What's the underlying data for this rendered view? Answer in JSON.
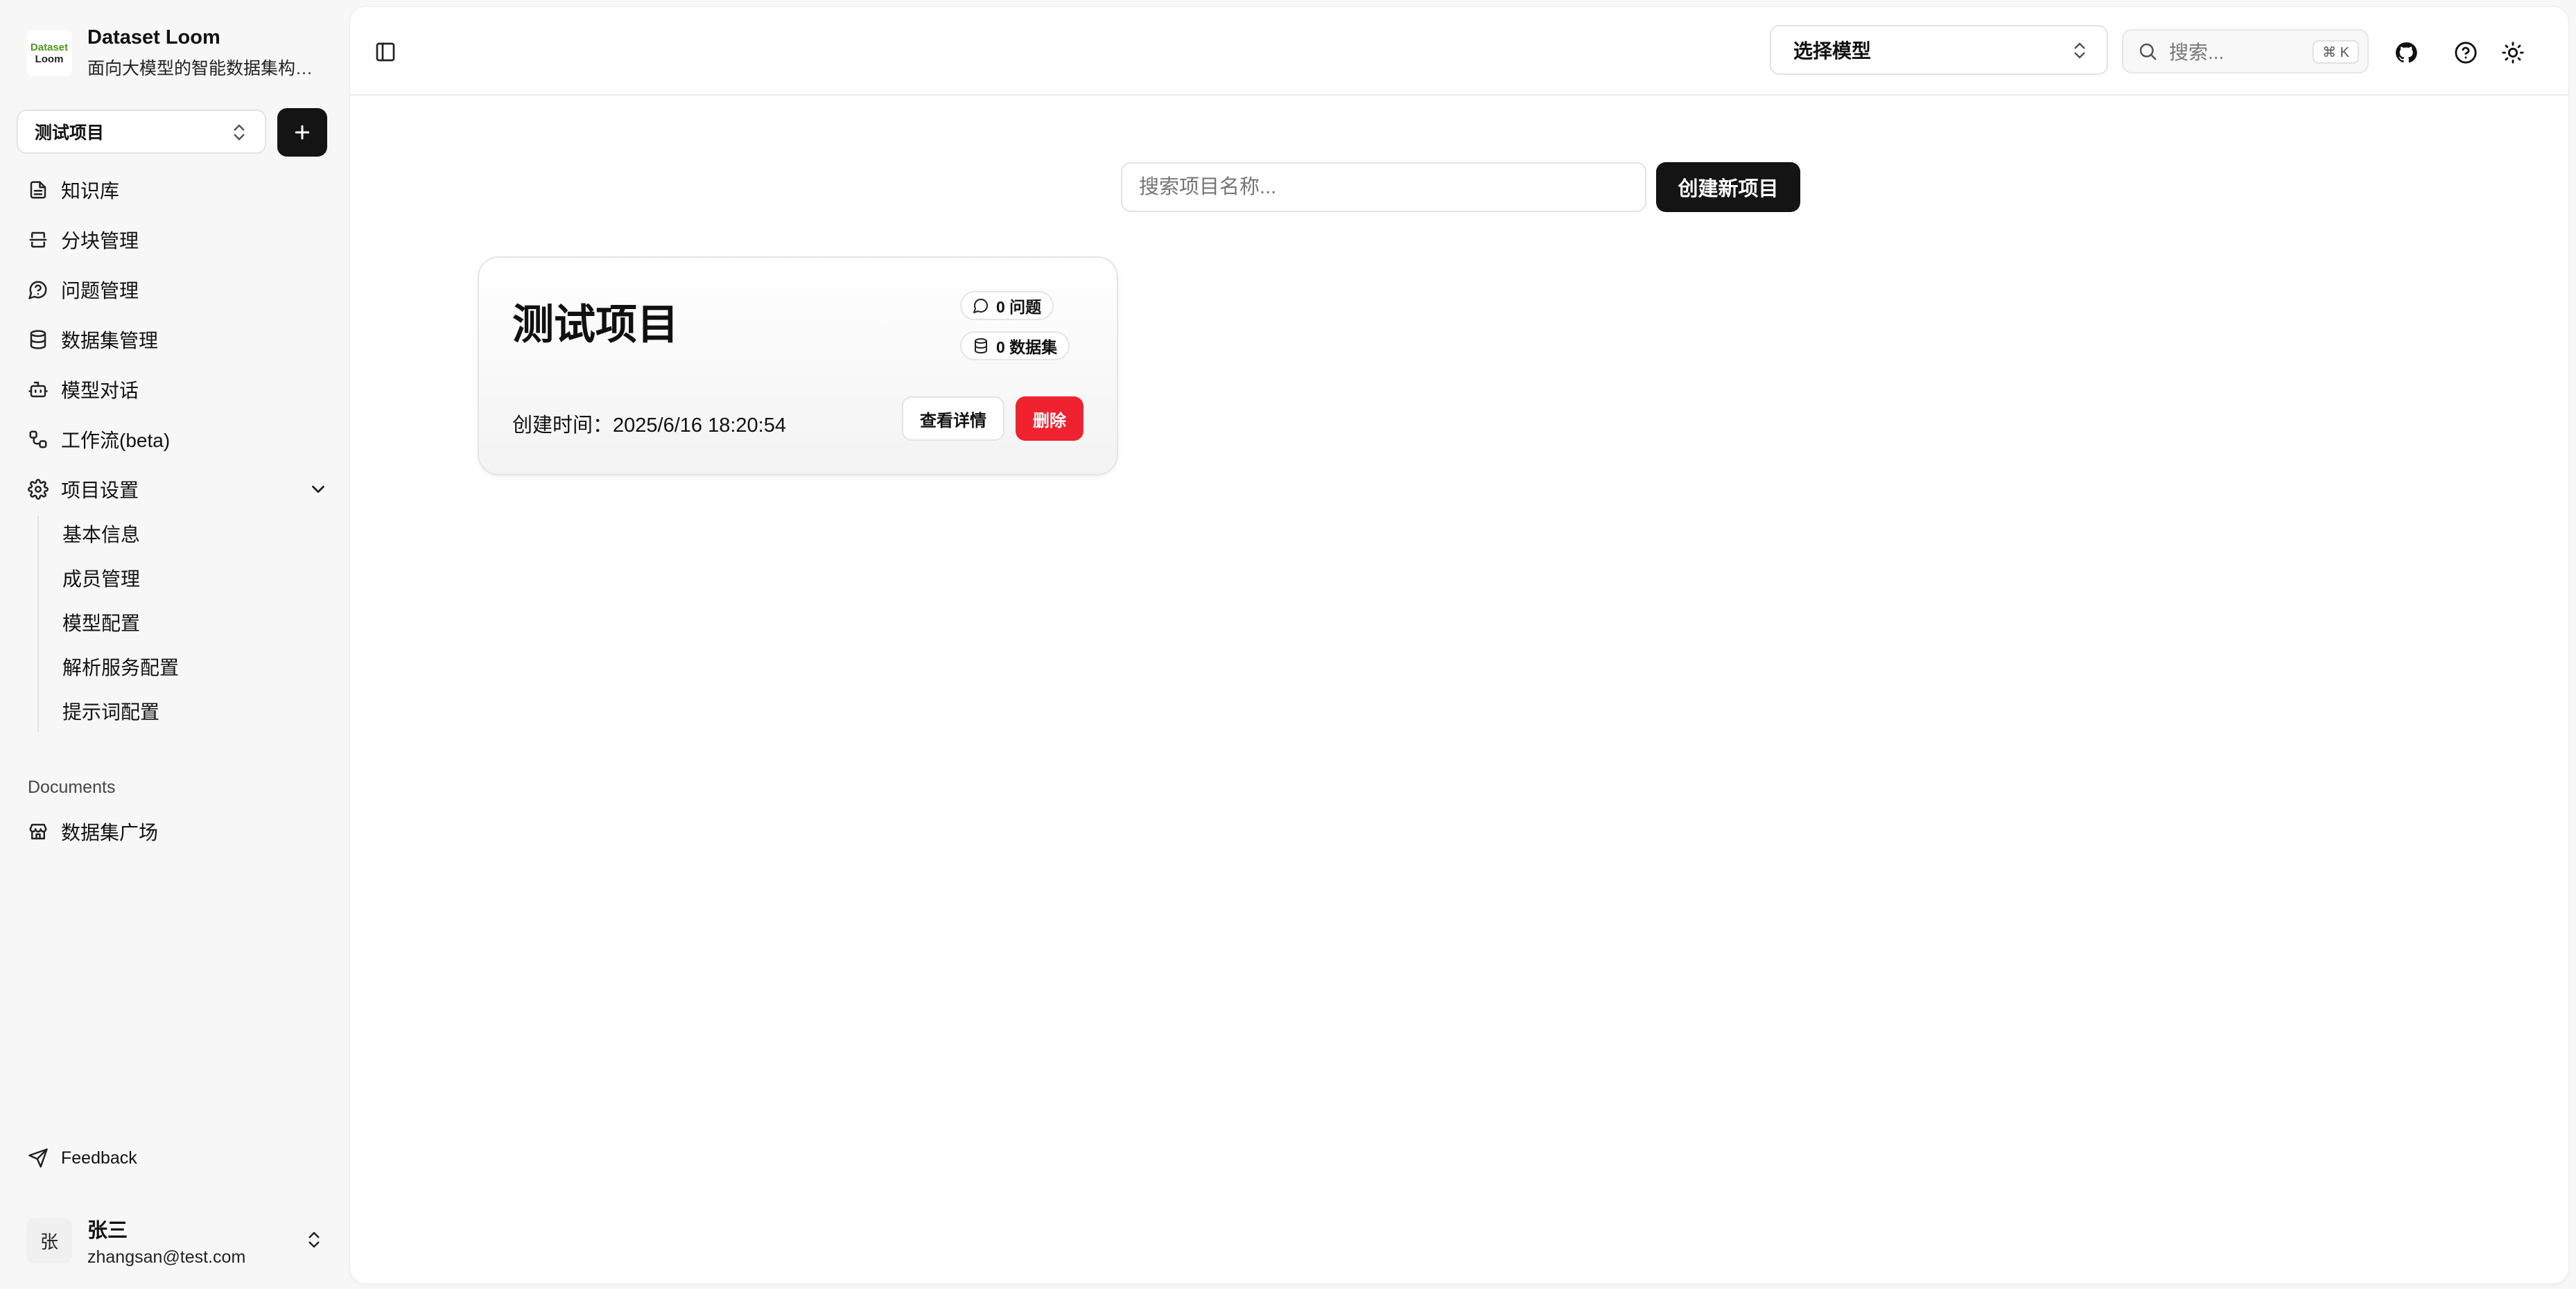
{
  "brand": {
    "logo_top": "Dataset",
    "logo_bottom": "Loom",
    "title": "Dataset Loom",
    "subtitle": "面向大模型的智能数据集构建..."
  },
  "project_selector": {
    "value": "测试项目"
  },
  "nav": {
    "items": [
      {
        "label": "知识库",
        "icon": "file-text-icon"
      },
      {
        "label": "分块管理",
        "icon": "split-icon"
      },
      {
        "label": "问题管理",
        "icon": "message-circle-question-icon"
      },
      {
        "label": "数据集管理",
        "icon": "database-icon"
      },
      {
        "label": "模型对话",
        "icon": "bot-icon"
      },
      {
        "label": "工作流(beta)",
        "icon": "workflow-icon"
      },
      {
        "label": "项目设置",
        "icon": "gear-icon"
      }
    ],
    "settings_children": [
      "基本信息",
      "成员管理",
      "模型配置",
      "解析服务配置",
      "提示词配置"
    ]
  },
  "documents": {
    "section_label": "Documents",
    "items": [
      {
        "label": "数据集广场",
        "icon": "store-icon"
      }
    ]
  },
  "feedback": {
    "label": "Feedback"
  },
  "user": {
    "avatar": "张",
    "name": "张三",
    "email": "zhangsan@test.com"
  },
  "topbar": {
    "model_select": "选择模型",
    "search_placeholder": "搜索...",
    "search_shortcut": "⌘ K"
  },
  "content": {
    "search_placeholder": "搜索项目名称...",
    "create_button": "创建新项目",
    "projects": [
      {
        "name": "测试项目",
        "questions_badge": "0 问题",
        "datasets_badge": "0 数据集",
        "created_label": "创建时间：2025/6/16 18:20:54",
        "detail_button": "查看详情",
        "delete_button": "删除"
      }
    ]
  },
  "colors": {
    "accent": "#141414",
    "danger": "#f1222f",
    "logo_green": "#4c9a1a"
  }
}
